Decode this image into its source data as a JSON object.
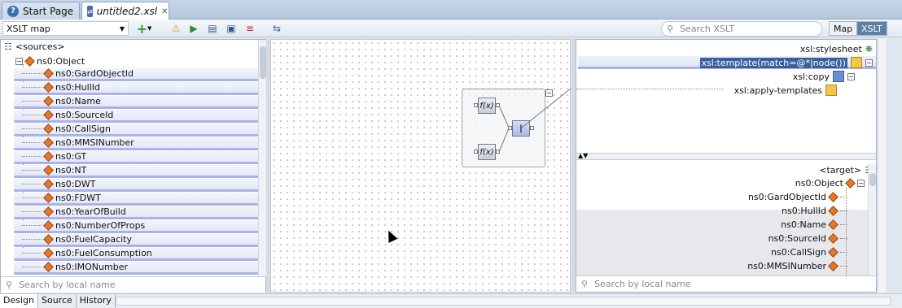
{
  "tabs": [
    {
      "label": "Start Page",
      "icon": "start-page-icon"
    },
    {
      "label": "untitled2.xsl",
      "icon": "xsl-file-icon",
      "active": true
    }
  ],
  "toolbar": {
    "map_select_value": "XSLT map",
    "search_placeholder": "Search XSLT",
    "map_button": "Map",
    "xslt_button": "XSLT"
  },
  "sources": {
    "header": "<sources>",
    "root": "ns0:Object",
    "items": [
      "ns0:GardObjectId",
      "ns0:HullId",
      "ns0:Name",
      "ns0:SourceId",
      "ns0:CallSign",
      "ns0:MMSINumber",
      "ns0:GT",
      "ns0:NT",
      "ns0:DWT",
      "ns0:FDWT",
      "ns0:YearOfBuild",
      "ns0:NumberOfProps",
      "ns0:FuelCapacity",
      "ns0:FuelConsumption",
      "ns0:IMONumber"
    ],
    "search_placeholder": "Search by local name"
  },
  "canvas": {
    "func1": "f(x)",
    "func2": "f(x)",
    "pipe": "|"
  },
  "xsl_tree": {
    "stylesheet": "xsl:stylesheet",
    "template": "xsl:template(match=@*|node())",
    "copy": "xsl:copy",
    "apply": "xsl:apply-templates"
  },
  "target": {
    "header": "<target>",
    "root": "ns0:Object",
    "items": [
      "ns0:GardObjectId",
      "ns0:HullId",
      "ns0:Name",
      "ns0:SourceId",
      "ns0:CallSign",
      "ns0:MMSINumber"
    ],
    "search_placeholder": "Search by local name"
  },
  "bottom_tabs": [
    "Design",
    "Source",
    "History"
  ],
  "colors": {
    "accent": "#3b5f9d",
    "node": "#e07a2a",
    "row_underline": "#a9b3e8"
  }
}
